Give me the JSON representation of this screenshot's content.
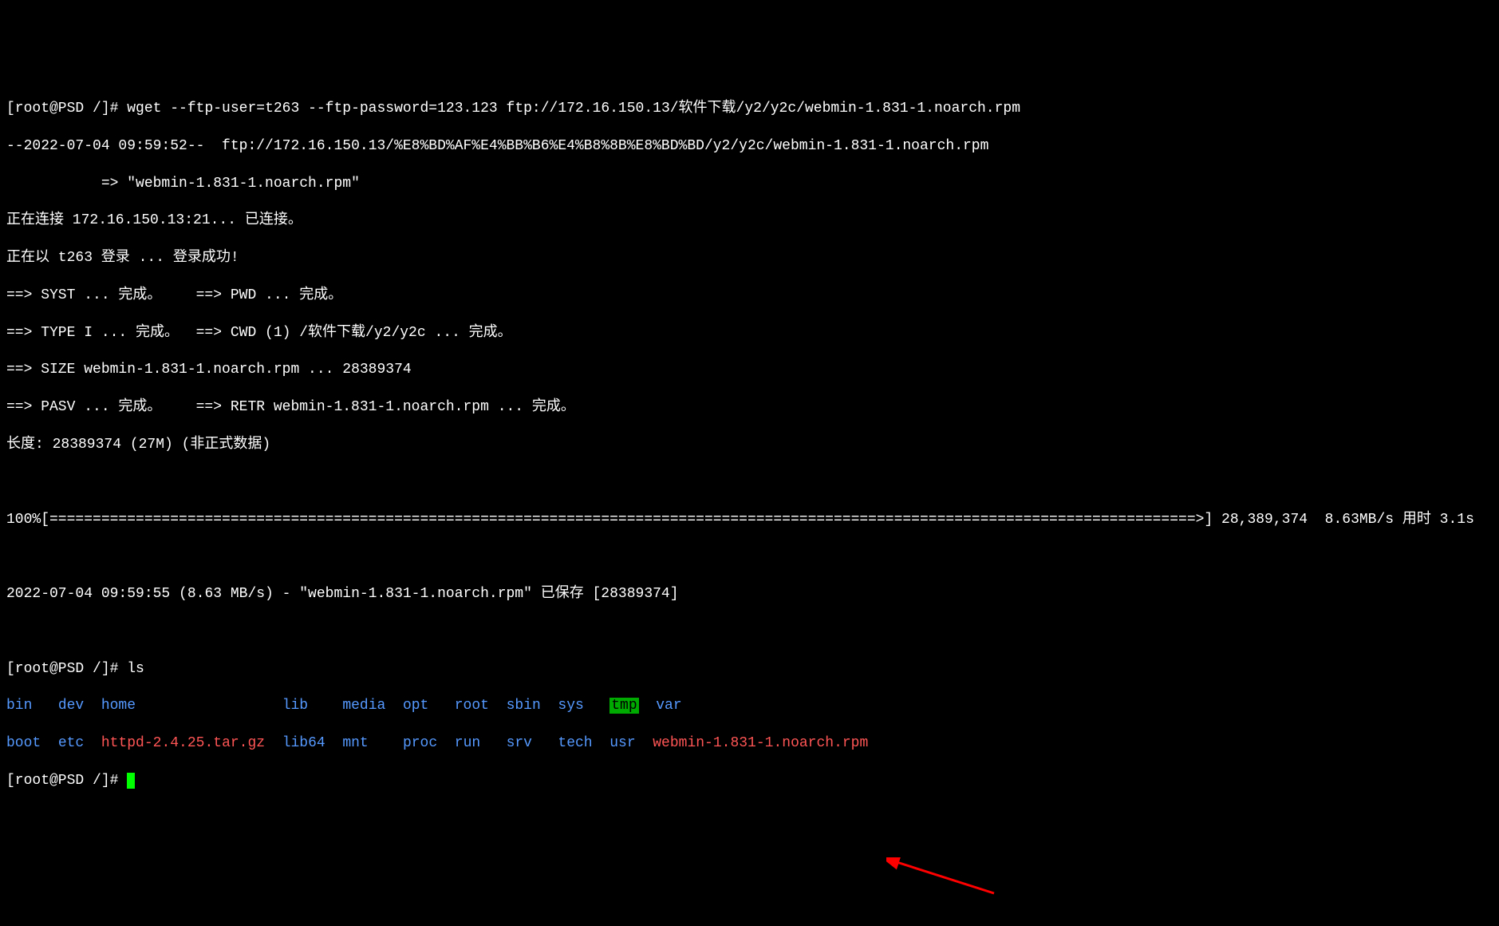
{
  "terminal": {
    "prompt1": "[root@PSD /]# ",
    "command1": "wget --ftp-user=t263 --ftp-password=123.123 ftp://172.16.150.13/软件下载/y2/y2c/webmin-1.831-1.noarch.rpm",
    "line2": "--2022-07-04 09:59:52--  ftp://172.16.150.13/%E8%BD%AF%E4%BB%B6%E4%B8%8B%E8%BD%BD/y2/y2c/webmin-1.831-1.noarch.rpm",
    "line3": "           => \"webmin-1.831-1.noarch.rpm\"",
    "line4": "正在连接 172.16.150.13:21... 已连接。",
    "line5": "正在以 t263 登录 ... 登录成功!",
    "line6": "==> SYST ... 完成。    ==> PWD ... 完成。",
    "line7": "==> TYPE I ... 完成。  ==> CWD (1) /软件下载/y2/y2c ... 完成。",
    "line8": "==> SIZE webmin-1.831-1.noarch.rpm ... 28389374",
    "line9": "==> PASV ... 完成。    ==> RETR webmin-1.831-1.noarch.rpm ... 完成。",
    "line10": "长度: 28389374 (27M) (非正式数据)",
    "progress_line": "100%[=====================================================================================================================================>] 28,389,374  8.63MB/s 用时 3.1s",
    "summary_line": "2022-07-04 09:59:55 (8.63 MB/s) - \"webmin-1.831-1.noarch.rpm\" 已保存 [28389374]",
    "prompt2": "[root@PSD /]# ",
    "command2": "ls",
    "prompt3": "[root@PSD /]# ",
    "ls_output": {
      "row1": {
        "bin": "bin",
        "dev": "dev",
        "home": "home",
        "lib": "lib",
        "media": "media",
        "opt": "opt",
        "root": "root",
        "sbin": "sbin",
        "sys": "sys",
        "tmp": "tmp",
        "var": "var"
      },
      "row2": {
        "boot": "boot",
        "etc": "etc",
        "httpd": "httpd-2.4.25.tar.gz",
        "lib64": "lib64",
        "mnt": "mnt",
        "proc": "proc",
        "run": "run",
        "srv": "srv",
        "tech": "tech",
        "usr": "usr",
        "webmin": "webmin-1.831-1.noarch.rpm"
      }
    }
  }
}
